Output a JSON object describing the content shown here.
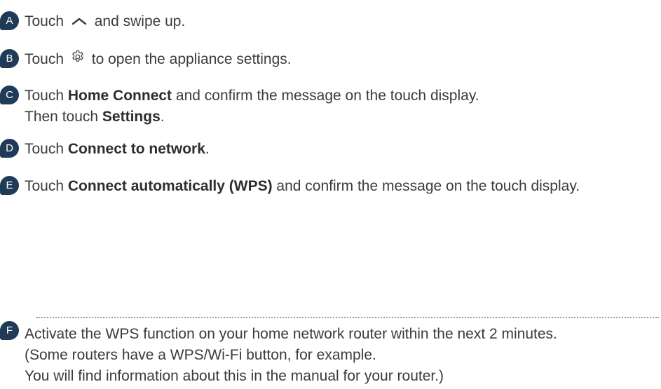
{
  "steps": [
    {
      "letter": "A",
      "pre": "Touch",
      "icon": "chevron-up-icon",
      "post": "and swipe up."
    },
    {
      "letter": "B",
      "pre": "Touch",
      "icon": "gear-icon",
      "post": "to open the appliance settings."
    },
    {
      "letter": "C",
      "pre": "Touch ",
      "bold": "Home Connect",
      "post": " and confirm the message on the touch display.",
      "line2_pre": "Then touch ",
      "line2_bold": "Settings",
      "line2_post": "."
    },
    {
      "letter": "D",
      "pre": "Touch ",
      "bold": "Connect to network",
      "post": "."
    },
    {
      "letter": "E",
      "pre": "Touch ",
      "bold": "Connect automatically (WPS)",
      "post": " and confirm the message on the touch display."
    },
    {
      "letter": "F",
      "lines": [
        "Activate the WPS function on your home network router within the next 2 minutes.",
        "(Some routers have a WPS/Wi-Fi button, for example.",
        "You will find information about this in the manual for your router.)"
      ]
    }
  ],
  "colors": {
    "badge": "#1f3b57",
    "text": "#3b3b3b",
    "divider": "#9a9a9a"
  }
}
